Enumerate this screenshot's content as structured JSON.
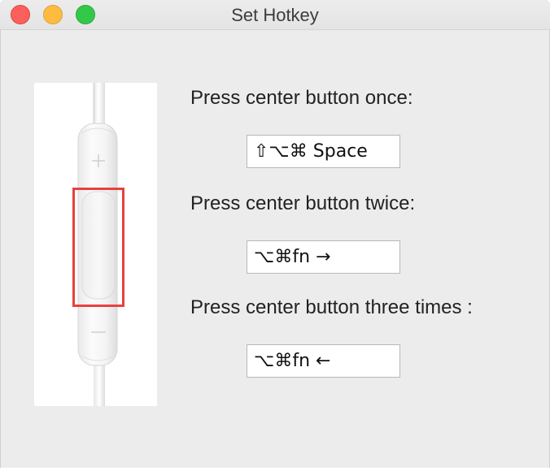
{
  "window": {
    "title": "Set Hotkey"
  },
  "traffic_lights": {
    "close_color": "#fc605c",
    "minimize_color": "#fdbc40",
    "zoom_color": "#34c84a"
  },
  "remote_image": {
    "plus_symbol": "+",
    "minus_symbol": "—",
    "highlight_color": "#e8413d"
  },
  "settings": [
    {
      "label": "Press center button once:",
      "hotkey": "⇧⌥⌘ Space"
    },
    {
      "label": "Press center button twice:",
      "hotkey": "⌥⌘fn →"
    },
    {
      "label": "Press center button three times :",
      "hotkey": "⌥⌘fn ←"
    }
  ]
}
